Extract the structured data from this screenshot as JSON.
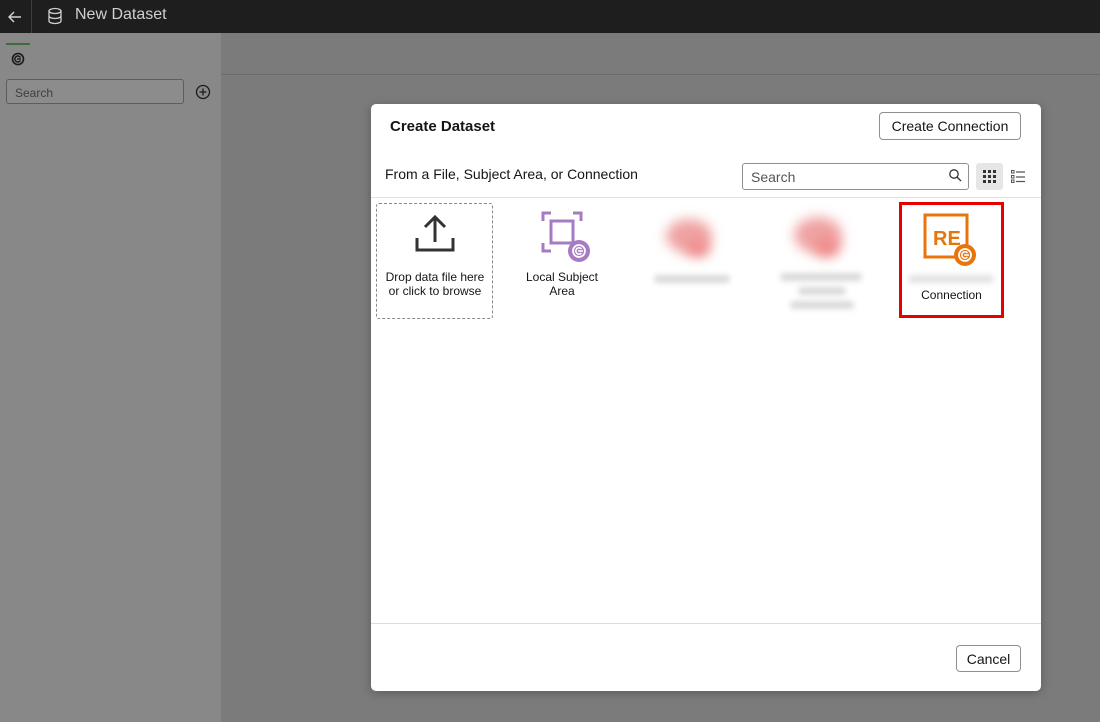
{
  "app": {
    "title": "New Dataset",
    "back_icon": "arrow-left-icon",
    "dataset_icon": "database-icon"
  },
  "left_panel": {
    "search_placeholder": "Search",
    "add_icon": "plus-circle-icon",
    "tab_icon": "connection-icon"
  },
  "dialog": {
    "title": "Create Dataset",
    "create_connection_label": "Create Connection",
    "subtitle": "From a File, Subject Area, or Connection",
    "search_placeholder": "Search",
    "view_grid_icon": "grid-view-icon",
    "view_list_icon": "list-view-icon",
    "cancel_label": "Cancel",
    "tiles": [
      {
        "label": "Drop data file here or click to browse",
        "icon": "upload-icon"
      },
      {
        "label": "Local Subject Area",
        "icon": "subject-area-icon"
      },
      {
        "label": "Connection",
        "icon": "re-connection-icon"
      }
    ]
  },
  "colors": {
    "topbar": "#1e1e1e",
    "subject_area_purple": "#a77bc2",
    "re_orange": "#e8740c",
    "highlight_red": "#e60000"
  }
}
